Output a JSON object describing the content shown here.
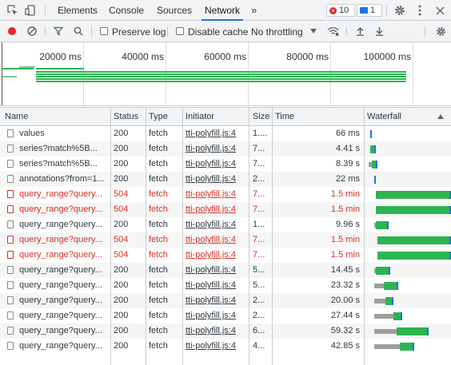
{
  "colors": {
    "accent": "#1a73e8",
    "error": "#d93025",
    "bar_green": "#2db551",
    "bar_gray": "#9e9e9e"
  },
  "tabs": [
    {
      "label": "Elements"
    },
    {
      "label": "Console"
    },
    {
      "label": "Sources"
    },
    {
      "label": "Network",
      "active": true
    },
    {
      "label": "»"
    }
  ],
  "badges": {
    "errors": "10",
    "messages": "1"
  },
  "toolbar": {
    "preserve_log": "Preserve log",
    "disable_cache": "Disable cache",
    "throttling": "No throttling"
  },
  "overview": {
    "ticks": [
      "20000 ms",
      "40000 ms",
      "60000 ms",
      "80000 ms",
      "100000 ms"
    ]
  },
  "table": {
    "headers": {
      "name": "Name",
      "status": "Status",
      "type": "Type",
      "initiator": "Initiator",
      "size": "Size",
      "time": "Time",
      "waterfall": "Waterfall"
    },
    "rows": [
      {
        "name": "values",
        "status": "200",
        "type": "fetch",
        "initiator": "tti-polyfill.js:4",
        "size": "1....",
        "time": "66 ms",
        "error": false
      },
      {
        "name": "series?match%5B...",
        "status": "200",
        "type": "fetch",
        "initiator": "tti-polyfill.js:4",
        "size": "7...",
        "time": "4.41 s",
        "error": false
      },
      {
        "name": "series?match%5B...",
        "status": "200",
        "type": "fetch",
        "initiator": "tti-polyfill.js:4",
        "size": "7...",
        "time": "8.39 s",
        "error": false
      },
      {
        "name": "annotations?from=1...",
        "status": "200",
        "type": "fetch",
        "initiator": "tti-polyfill.js:4",
        "size": "2...",
        "time": "22 ms",
        "error": false
      },
      {
        "name": "query_range?query...",
        "status": "504",
        "type": "fetch",
        "initiator": "tti-polyfill.js:4",
        "size": "7...",
        "time": "1.5 min",
        "error": true
      },
      {
        "name": "query_range?query...",
        "status": "504",
        "type": "fetch",
        "initiator": "tti-polyfill.js:4",
        "size": "7...",
        "time": "1.5 min",
        "error": true
      },
      {
        "name": "query_range?query...",
        "status": "200",
        "type": "fetch",
        "initiator": "tti-polyfill.js:4",
        "size": "1...",
        "time": "9.96 s",
        "error": false
      },
      {
        "name": "query_range?query...",
        "status": "504",
        "type": "fetch",
        "initiator": "tti-polyfill.js:4",
        "size": "7...",
        "time": "1.5 min",
        "error": true
      },
      {
        "name": "query_range?query...",
        "status": "504",
        "type": "fetch",
        "initiator": "tti-polyfill.js:4",
        "size": "7...",
        "time": "1.5 min",
        "error": true
      },
      {
        "name": "query_range?query...",
        "status": "200",
        "type": "fetch",
        "initiator": "tti-polyfill.js:4",
        "size": "5...",
        "time": "14.45 s",
        "error": false
      },
      {
        "name": "query_range?query...",
        "status": "200",
        "type": "fetch",
        "initiator": "tti-polyfill.js:4",
        "size": "5...",
        "time": "23.32 s",
        "error": false
      },
      {
        "name": "query_range?query...",
        "status": "200",
        "type": "fetch",
        "initiator": "tti-polyfill.js:4",
        "size": "2...",
        "time": "20.00 s",
        "error": false
      },
      {
        "name": "query_range?query...",
        "status": "200",
        "type": "fetch",
        "initiator": "tti-polyfill.js:4",
        "size": "2...",
        "time": "27.44 s",
        "error": false
      },
      {
        "name": "query_range?query...",
        "status": "200",
        "type": "fetch",
        "initiator": "tti-polyfill.js:4",
        "size": "6...",
        "time": "59.32 s",
        "error": false
      },
      {
        "name": "query_range?query...",
        "status": "200",
        "type": "fetch",
        "initiator": "tti-polyfill.js:4",
        "size": "4...",
        "time": "42.85 s",
        "error": false
      }
    ]
  }
}
